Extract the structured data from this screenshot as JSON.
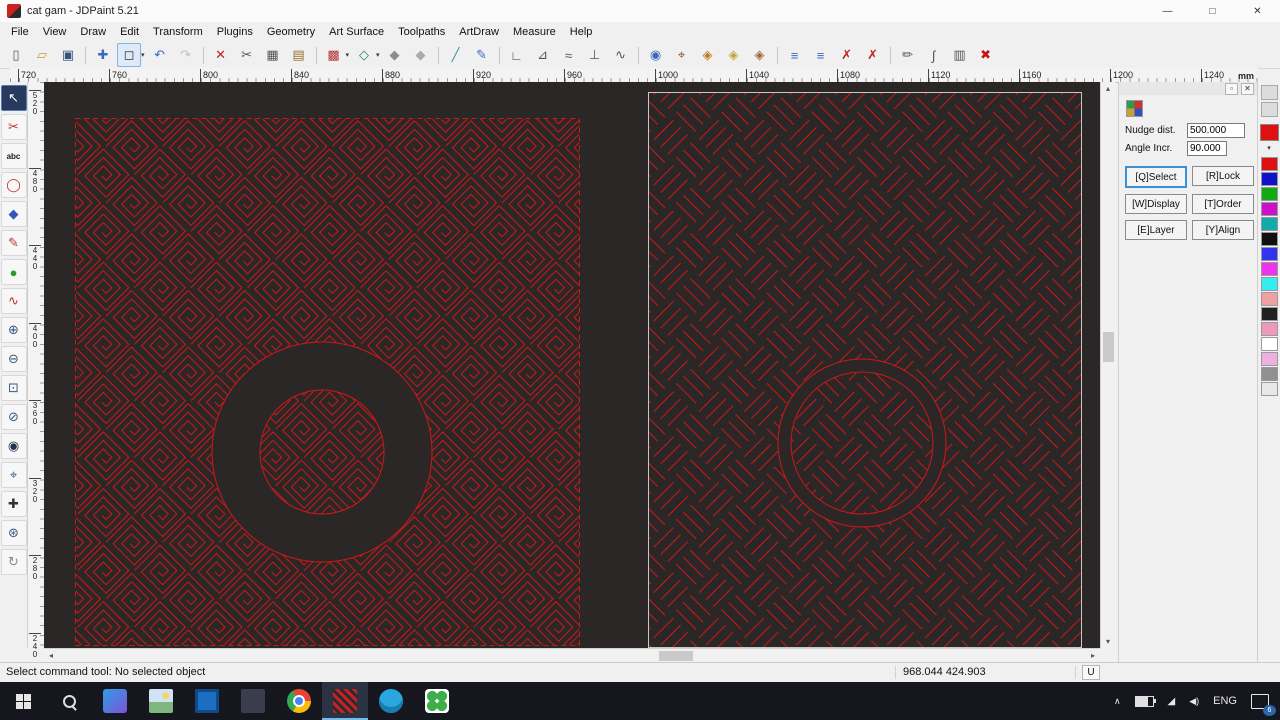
{
  "colors": {
    "canvas-bg": "#2b2727",
    "pattern-red": "#cf1717",
    "chrome-bg": "#f0f0f0",
    "taskbar-bg": "#16161f",
    "accent": "#3d8fd4"
  },
  "window": {
    "title": "cat gam - JDPaint 5.21",
    "minimize_glyph": "—",
    "maximize_glyph": "□",
    "close_glyph": "✕"
  },
  "glyphs": {
    "dropdown": "▾"
  },
  "menu": [
    "File",
    "View",
    "Draw",
    "Edit",
    "Transform",
    "Plugins",
    "Geometry",
    "Art Surface",
    "Toolpaths",
    "ArtDraw",
    "Measure",
    "Help"
  ],
  "toolbar": [
    {
      "name": "new-file",
      "glyph": "▯",
      "color": "#5a5a5a"
    },
    {
      "name": "open-file",
      "glyph": "▱",
      "color": "#c99a2e"
    },
    {
      "name": "save-file",
      "glyph": "▣",
      "color": "#33557f"
    },
    {
      "sep": true
    },
    {
      "name": "move",
      "glyph": "✚",
      "color": "#3a6abf"
    },
    {
      "name": "select-rect",
      "glyph": "◻",
      "color": "#333333",
      "active": true,
      "dropdown": true
    },
    {
      "name": "undo",
      "glyph": "↶",
      "color": "#3a6abf"
    },
    {
      "name": "redo",
      "glyph": "↷",
      "color": "#999999",
      "disabled": true
    },
    {
      "sep": true
    },
    {
      "name": "delete",
      "glyph": "✕",
      "color": "#c32222"
    },
    {
      "name": "cut",
      "glyph": "✂",
      "color": "#555555"
    },
    {
      "name": "copy",
      "glyph": "▦",
      "color": "#555555"
    },
    {
      "name": "paste",
      "glyph": "▤",
      "color": "#96702e"
    },
    {
      "sep": true
    },
    {
      "name": "hatch-fill",
      "glyph": "▩",
      "color": "#b33333",
      "dropdown": true
    },
    {
      "name": "contour-fill",
      "glyph": "◇",
      "color": "#2e8050",
      "dropdown": true
    },
    {
      "name": "shield-a",
      "glyph": "◆",
      "color": "#8a8a92"
    },
    {
      "name": "shield-b",
      "glyph": "◆",
      "color": "#aaaab2"
    },
    {
      "sep": true
    },
    {
      "name": "draw-line",
      "glyph": "╱",
      "color": "#2a9a9a"
    },
    {
      "name": "node-edit",
      "glyph": "✎",
      "color": "#3a6abf"
    },
    {
      "sep": true
    },
    {
      "name": "corner",
      "glyph": "∟",
      "color": "#555555"
    },
    {
      "name": "mirror",
      "glyph": "⊿",
      "color": "#555555"
    },
    {
      "name": "offset",
      "glyph": "≈",
      "color": "#555555"
    },
    {
      "name": "perpendicular",
      "glyph": "⊥",
      "color": "#555555"
    },
    {
      "name": "smooth",
      "glyph": "∿",
      "color": "#555555"
    },
    {
      "sep": true
    },
    {
      "name": "view-eye",
      "glyph": "◉",
      "color": "#3a6abf"
    },
    {
      "name": "carve",
      "glyph": "⌖",
      "color": "#8a4a2a"
    },
    {
      "name": "surface-a",
      "glyph": "◈",
      "color": "#c07820"
    },
    {
      "name": "surface-b",
      "glyph": "◈",
      "color": "#caa23c"
    },
    {
      "name": "surface-c",
      "glyph": "◈",
      "color": "#9a6a2a"
    },
    {
      "sep": true
    },
    {
      "name": "align-h",
      "glyph": "≡",
      "color": "#3a6abf"
    },
    {
      "name": "align-v",
      "glyph": "≡",
      "color": "#3a6abf"
    },
    {
      "name": "snap-clear-a",
      "glyph": "✗",
      "color": "#c32222"
    },
    {
      "name": "snap-clear-b",
      "glyph": "✗",
      "color": "#c32222"
    },
    {
      "sep": true
    },
    {
      "name": "engrave-pen",
      "glyph": "✏",
      "color": "#555555"
    },
    {
      "name": "tool-path",
      "glyph": "∫",
      "color": "#555555"
    },
    {
      "name": "sheet",
      "glyph": "▥",
      "color": "#555555"
    },
    {
      "name": "abort",
      "glyph": "✖",
      "color": "#c31515"
    }
  ],
  "side_toolbar": [
    {
      "name": "pick-tool",
      "glyph": "↖",
      "active": true
    },
    {
      "name": "knife-tool",
      "glyph": "✂",
      "color": "#c03030"
    },
    {
      "name": "text-tool",
      "glyph": "abc",
      "text": true,
      "color": "#1a1a1a"
    },
    {
      "name": "outline-tool",
      "glyph": "◯",
      "color": "#c03030"
    },
    {
      "name": "diamond-tool",
      "glyph": "◆",
      "color": "#3555b5"
    },
    {
      "name": "brush-tool",
      "glyph": "✎",
      "color": "#c03030"
    },
    {
      "name": "sphere-tool",
      "glyph": "●",
      "color": "#2a9a2a"
    },
    {
      "name": "spline-tool",
      "glyph": "∿",
      "color": "#c03030"
    },
    {
      "name": "zoom-in-tool",
      "glyph": "⊕",
      "color": "#355a7f"
    },
    {
      "name": "zoom-out-tool",
      "glyph": "⊖",
      "color": "#355a7f"
    },
    {
      "name": "zoom-window-tool",
      "glyph": "⊡",
      "color": "#355a7f"
    },
    {
      "name": "clip-view-tool",
      "glyph": "⊘",
      "color": "#355a7f"
    },
    {
      "name": "preview-tool",
      "glyph": "◉",
      "color": "#22304f"
    },
    {
      "name": "locate-tool",
      "glyph": "⌖",
      "color": "#355a7f"
    },
    {
      "name": "pan-tool",
      "glyph": "✚",
      "color": "#333333"
    },
    {
      "name": "magnify-tool",
      "glyph": "⊛",
      "color": "#355a7f"
    },
    {
      "name": "refresh-tool",
      "glyph": "↻",
      "color": "#8a8a8a"
    }
  ],
  "ruler": {
    "h_labels": [
      "720",
      "760",
      "800",
      "840",
      "880",
      "920",
      "960",
      "1000",
      "1040",
      "1080",
      "1120",
      "1160",
      "1200",
      "1240"
    ],
    "v_labels": [
      "520",
      "480",
      "440",
      "400",
      "360",
      "320",
      "280",
      "240"
    ],
    "unit": "mm"
  },
  "dock": {
    "float_glyph": "▫",
    "close_glyph": "✕",
    "nudge_label": "Nudge dist.",
    "nudge_value": "500.000",
    "angle_label": "Angle Incr.",
    "angle_value": "90.000",
    "buttons": [
      "[Q]Select",
      "[R]Lock",
      "[W]Display",
      "[T]Order",
      "[E]Layer",
      "[Y]Align"
    ],
    "active_button": "[Q]Select"
  },
  "palette": {
    "current": "#dd1111",
    "expand_glyph": "▾",
    "swatches": [
      "#dd1111",
      "#1111cc",
      "#11aa11",
      "#cc11cc",
      "#11aaaa",
      "#101010",
      "#3333ee",
      "#ee33ee",
      "#33eeee",
      "#f0a0a0",
      "#202020",
      "#ee99bb",
      "#ffffff",
      "#eeb0e0",
      "#909090",
      "#e8e8e8"
    ]
  },
  "scroll": {
    "left_glyph": "◂",
    "right_glyph": "▸",
    "up_glyph": "▴",
    "down_glyph": "▾"
  },
  "status": {
    "message": "Select command tool: No selected object",
    "coords": "968.044 424.903",
    "flag": "U"
  },
  "taskbar": {
    "chevron_glyph": "∧",
    "net_glyph": "◢",
    "volume_glyph": "◀)",
    "language": "ENG",
    "badge": "6"
  }
}
